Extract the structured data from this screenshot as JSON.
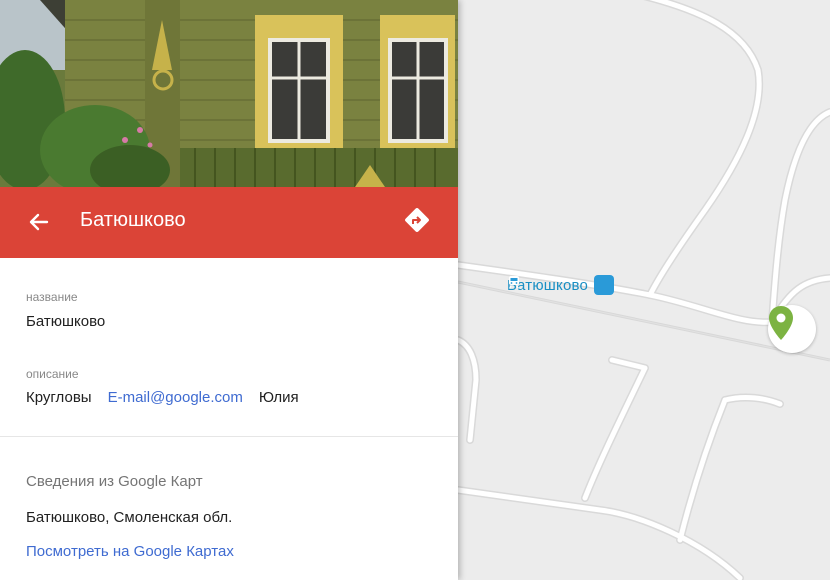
{
  "map": {
    "station_label": "Батюшково",
    "pin_color": "#7cb342",
    "station_icon": "train-station-icon"
  },
  "panel": {
    "header": {
      "title": "Батюшково",
      "color": "#db4437",
      "back_icon": "arrow-left-icon",
      "directions_icon": "directions-icon"
    },
    "name_field": {
      "label": "название",
      "value": "Батюшково"
    },
    "description_field": {
      "label": "описание",
      "parts": [
        "Кругловы",
        "E-mail@google.com",
        "Юлия"
      ]
    },
    "google_info": {
      "title": "Сведения из Google Карт",
      "address": "Батюшково, Смоленская обл.",
      "link": "Посмотреть на Google Картах"
    }
  }
}
